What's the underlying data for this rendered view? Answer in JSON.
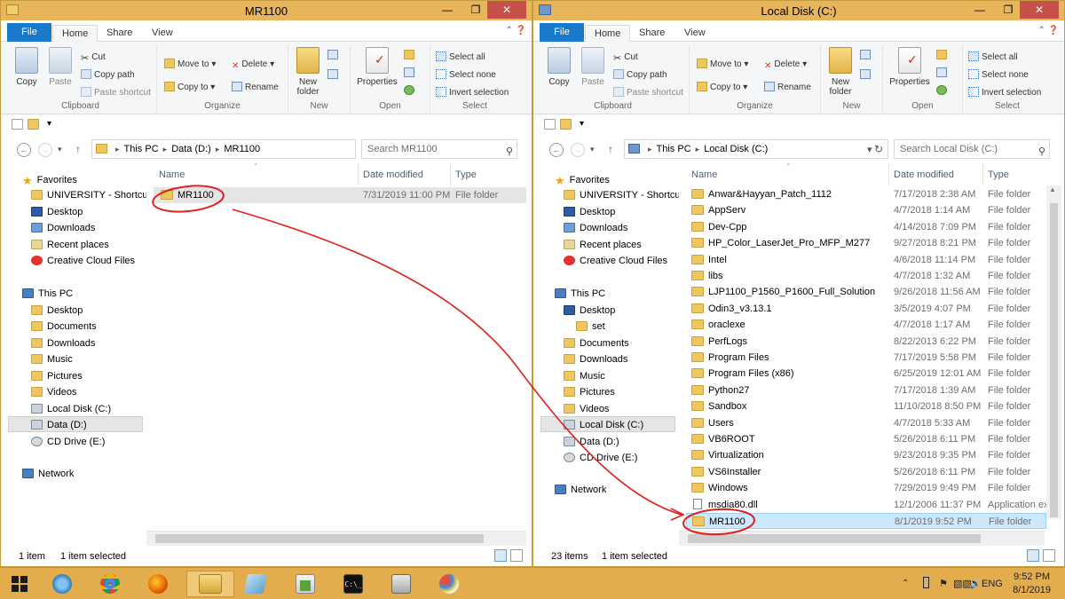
{
  "left": {
    "title": "MR1100",
    "tabs": [
      "File",
      "Home",
      "Share",
      "View"
    ],
    "ribbon": {
      "clipboard": {
        "copy": "Copy",
        "paste": "Paste",
        "cut": "Cut",
        "copy_path": "Copy path",
        "paste_shortcut": "Paste shortcut",
        "label": "Clipboard"
      },
      "organize": {
        "move_to": "Move to",
        "copy_to": "Copy to",
        "delete": "Delete",
        "rename": "Rename",
        "label": "Organize"
      },
      "new": {
        "new_folder": "New folder",
        "label": "New"
      },
      "open": {
        "properties": "Properties",
        "label": "Open"
      },
      "select": {
        "select_all": "Select all",
        "select_none": "Select none",
        "invert": "Invert selection",
        "label": "Select"
      }
    },
    "address": [
      "This PC",
      "Data (D:)",
      "MR1100"
    ],
    "search_placeholder": "Search MR1100",
    "nav": {
      "favorites": "Favorites",
      "fav_items": [
        "UNIVERSITY - Shortcut",
        "Desktop",
        "Downloads",
        "Recent places",
        "Creative Cloud Files"
      ],
      "thispc": "This PC",
      "pc_items": [
        "Desktop",
        "Documents",
        "Downloads",
        "Music",
        "Pictures",
        "Videos",
        "Local Disk (C:)",
        "Data (D:)",
        "CD Drive (E:)"
      ],
      "network": "Network"
    },
    "columns": [
      "Name",
      "Date modified",
      "Type"
    ],
    "rows": [
      {
        "name": "MR1100",
        "date": "7/31/2019 11:00 PM",
        "type": "File folder"
      }
    ],
    "status": {
      "count": "1 item",
      "selected": "1 item selected"
    }
  },
  "right": {
    "title": "Local Disk (C:)",
    "tabs": [
      "File",
      "Home",
      "Share",
      "View"
    ],
    "ribbon": {
      "clipboard": {
        "copy": "Copy",
        "paste": "Paste",
        "cut": "Cut",
        "copy_path": "Copy path",
        "paste_shortcut": "Paste shortcut",
        "label": "Clipboard"
      },
      "organize": {
        "move_to": "Move to",
        "copy_to": "Copy to",
        "delete": "Delete",
        "rename": "Rename",
        "label": "Organize"
      },
      "new": {
        "new_folder": "New folder",
        "label": "New"
      },
      "open": {
        "properties": "Properties",
        "label": "Open"
      },
      "select": {
        "select_all": "Select all",
        "select_none": "Select none",
        "invert": "Invert selection",
        "label": "Select"
      }
    },
    "address": [
      "This PC",
      "Local Disk (C:)"
    ],
    "search_placeholder": "Search Local Disk (C:)",
    "nav": {
      "favorites": "Favorites",
      "fav_items": [
        "UNIVERSITY - Shortcut",
        "Desktop",
        "Downloads",
        "Recent places",
        "Creative Cloud Files"
      ],
      "thispc": "This PC",
      "pc_items": [
        "Desktop",
        "set",
        "Documents",
        "Downloads",
        "Music",
        "Pictures",
        "Videos",
        "Local Disk (C:)",
        "Data (D:)",
        "CD Drive (E:)"
      ],
      "network": "Network"
    },
    "columns": [
      "Name",
      "Date modified",
      "Type"
    ],
    "rows": [
      {
        "name": "Anwar&Hayyan_Patch_1112",
        "date": "7/17/2018 2:38 AM",
        "type": "File folder"
      },
      {
        "name": "AppServ",
        "date": "4/7/2018 1:14 AM",
        "type": "File folder"
      },
      {
        "name": "Dev-Cpp",
        "date": "4/14/2018 7:09 PM",
        "type": "File folder"
      },
      {
        "name": "HP_Color_LaserJet_Pro_MFP_M277",
        "date": "9/27/2018 8:21 PM",
        "type": "File folder"
      },
      {
        "name": "Intel",
        "date": "4/6/2018 11:14 PM",
        "type": "File folder"
      },
      {
        "name": "libs",
        "date": "4/7/2018 1:32 AM",
        "type": "File folder"
      },
      {
        "name": "LJP1100_P1560_P1600_Full_Solution",
        "date": "9/26/2018 11:56 AM",
        "type": "File folder"
      },
      {
        "name": "Odin3_v3.13.1",
        "date": "3/5/2019 4:07 PM",
        "type": "File folder"
      },
      {
        "name": "oraclexe",
        "date": "4/7/2018 1:17 AM",
        "type": "File folder"
      },
      {
        "name": "PerfLogs",
        "date": "8/22/2013 6:22 PM",
        "type": "File folder"
      },
      {
        "name": "Program Files",
        "date": "7/17/2019 5:58 PM",
        "type": "File folder"
      },
      {
        "name": "Program Files (x86)",
        "date": "6/25/2019 12:01 AM",
        "type": "File folder"
      },
      {
        "name": "Python27",
        "date": "7/17/2018 1:39 AM",
        "type": "File folder"
      },
      {
        "name": "Sandbox",
        "date": "11/10/2018 8:50 PM",
        "type": "File folder"
      },
      {
        "name": "Users",
        "date": "4/7/2018 5:33 AM",
        "type": "File folder"
      },
      {
        "name": "VB6ROOT",
        "date": "5/26/2018 6:11 PM",
        "type": "File folder"
      },
      {
        "name": "Virtualization",
        "date": "9/23/2018 9:35 PM",
        "type": "File folder"
      },
      {
        "name": "VS6Installer",
        "date": "5/26/2018 6:11 PM",
        "type": "File folder"
      },
      {
        "name": "Windows",
        "date": "7/29/2019 9:49 PM",
        "type": "File folder"
      },
      {
        "name": "msdia80.dll",
        "date": "12/1/2006 11:37 PM",
        "type": "Application ex"
      },
      {
        "name": "MR1100",
        "date": "8/1/2019 9:52 PM",
        "type": "File folder"
      }
    ],
    "status": {
      "count": "23 items",
      "selected": "1 item selected"
    }
  },
  "taskbar": {
    "apps": [
      "start-icon",
      "ie-icon",
      "chrome-icon",
      "firefox-icon",
      "file-explorer-icon",
      "notepad-icon",
      "sql-icon",
      "cmd-icon",
      "calculator-icon",
      "paint-icon"
    ],
    "lang": "ENG",
    "time": "9:52 PM",
    "date": "8/1/2019"
  },
  "colors": {
    "accent": "#1979ca",
    "taskbar": "#e3ad4e",
    "titlebar": "#e8b55a",
    "annotation": "#e0201b",
    "selection": "#cce8ff"
  }
}
